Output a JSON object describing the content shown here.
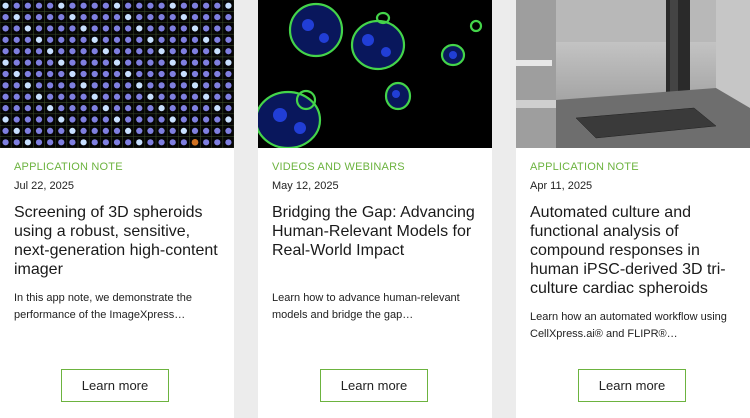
{
  "theme": {
    "accent": "#6cb33f",
    "card_bg": "#ffffff",
    "page_bg": "#ececec"
  },
  "cards": [
    {
      "category": "APPLICATION NOTE",
      "date": "Jul 22, 2025",
      "title": "Screening of 3D spheroids using a robust, sensitive, next-generation high-content imager",
      "description": "In this app note, we demonstrate the performance of the ImageXpress…",
      "button": "Learn more",
      "image_icon": "spheroid-well-grid"
    },
    {
      "category": "VIDEOS AND WEBINARS",
      "date": "May 12, 2025",
      "title": "Bridging the Gap: Advancing Human-Relevant Models for Real-World Impact",
      "description": "Learn how to advance human-relevant models and bridge the gap…",
      "button": "Learn more",
      "image_icon": "fluorescent-organoids"
    },
    {
      "category": "APPLICATION NOTE",
      "date": "Apr 11, 2025",
      "title": "Automated culture and functional analysis of compound responses in human iPSC-derived 3D tri-culture cardiac spheroids",
      "description": "Learn how an automated workflow using CellXpress.ai® and FLIPR®…",
      "button": "Learn more",
      "image_icon": "lab-automation-instrument"
    }
  ]
}
